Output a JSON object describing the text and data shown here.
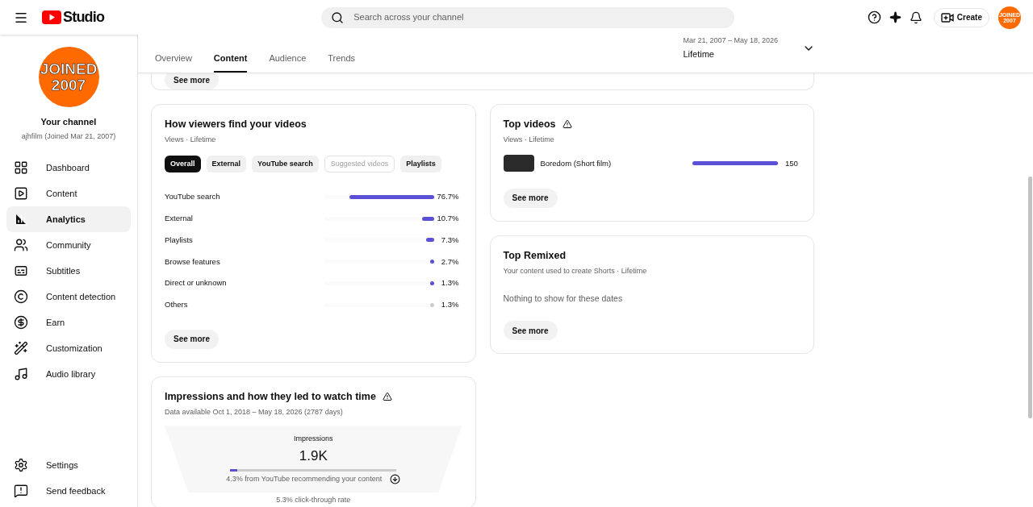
{
  "header": {
    "logo_text": "Studio",
    "search": {
      "placeholder": "Search across your channel"
    },
    "create_label": "Create",
    "avatar_lines": [
      "JOINED",
      "2007"
    ]
  },
  "sidebar": {
    "avatar_lines": [
      "JOINED",
      "2007"
    ],
    "channel_title": "Your channel",
    "channel_subtitle": "ajhfilm (Joined Mar 21, 2007)",
    "items": [
      {
        "kind": "dashboard",
        "label": "Dashboard",
        "selected": false
      },
      {
        "kind": "content",
        "label": "Content",
        "selected": false
      },
      {
        "kind": "analytics",
        "label": "Analytics",
        "selected": true
      },
      {
        "kind": "community",
        "label": "Community",
        "selected": false
      },
      {
        "kind": "subtitles",
        "label": "Subtitles",
        "selected": false
      },
      {
        "kind": "detection",
        "label": "Content detection",
        "selected": false
      },
      {
        "kind": "earn",
        "label": "Earn",
        "selected": false
      },
      {
        "kind": "customization",
        "label": "Customization",
        "selected": false
      },
      {
        "kind": "audio",
        "label": "Audio library",
        "selected": false
      }
    ],
    "bottom_items": [
      {
        "kind": "settings",
        "label": "Settings"
      },
      {
        "kind": "feedback",
        "label": "Send feedback"
      }
    ]
  },
  "tabs": [
    {
      "label": "Overview",
      "selected": false
    },
    {
      "label": "Content",
      "selected": true
    },
    {
      "label": "Audience",
      "selected": false
    },
    {
      "label": "Trends",
      "selected": false
    }
  ],
  "date_range": {
    "range": "Mar 21, 2007 – May 18, 2026",
    "label": "Lifetime"
  },
  "top_card": {
    "button": "See more"
  },
  "traffic_card": {
    "title": "How viewers find your videos",
    "subtitle": "Views · Lifetime",
    "chips": [
      {
        "label": "Overall",
        "selected": true,
        "disabled": false
      },
      {
        "label": "External",
        "selected": false,
        "disabled": false
      },
      {
        "label": "YouTube search",
        "selected": false,
        "disabled": false
      },
      {
        "label": "Suggested videos",
        "selected": false,
        "disabled": true
      },
      {
        "label": "Playlists",
        "selected": false,
        "disabled": false
      }
    ],
    "rows": [
      {
        "label": "YouTube search",
        "level": 0.767,
        "value": "76.7%",
        "color": "#5b50d6"
      },
      {
        "label": "External",
        "level": 0.107,
        "value": "10.7%",
        "color": "#5b50d6"
      },
      {
        "label": "Playlists",
        "level": 0.073,
        "value": "7.3%",
        "color": "#5b50d6"
      },
      {
        "label": "Browse features",
        "level": 0.027,
        "value": "2.7%",
        "color": "#5b50d6"
      },
      {
        "label": "Direct or unknown",
        "level": 0.013,
        "value": "1.3%",
        "color": "#5b50d6"
      },
      {
        "label": "Others",
        "level": 0.013,
        "value": "1.3%",
        "color": "#cccccc"
      }
    ],
    "button": "See more"
  },
  "impressions_card": {
    "title": "Impressions and how they led to watch time",
    "subtitle": "Data available Oct 1, 2018 – May 18, 2026 (2787 days)",
    "warning": true,
    "funnel_label": "Impressions",
    "funnel_value": "1.9K",
    "level": 0.043,
    "funnel_note": "4.3% from YouTube recommending your content",
    "next_step": "5.3% click-through rate"
  },
  "top_videos_card": {
    "title": "Top videos",
    "subtitle": "Views · Lifetime",
    "warning": true,
    "videos": [
      {
        "title": "Boredom (Short film)",
        "level": 1,
        "value": "150"
      }
    ],
    "button": "See more"
  },
  "remixed_card": {
    "title": "Top Remixed",
    "subtitle": "Your content used to create Shorts · Lifetime",
    "empty": "Nothing to show for these dates",
    "button": "See more"
  }
}
